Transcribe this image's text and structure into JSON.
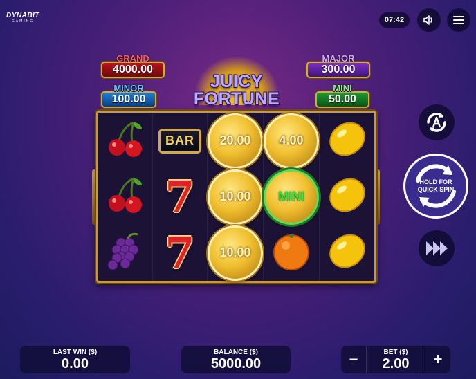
{
  "header": {
    "logo_line1": "DYNABIT",
    "logo_line2": "GAMING",
    "clock": "07:42"
  },
  "jackpots": {
    "grand": {
      "label": "GRAND",
      "value": "4000.00"
    },
    "minor": {
      "label": "MINOR",
      "value": "100.00"
    },
    "major": {
      "label": "MAJOR",
      "value": "300.00"
    },
    "mini": {
      "label": "MINI",
      "value": "50.00"
    }
  },
  "title": {
    "line1": "JUICY",
    "line2": "FORTUNE"
  },
  "reels": {
    "r0": [
      {
        "type": "cherry"
      },
      {
        "type": "bar",
        "text": "BAR"
      },
      {
        "type": "coin",
        "text": "20.00"
      },
      {
        "type": "coin",
        "text": "4.00"
      },
      {
        "type": "lemon"
      }
    ],
    "r1": [
      {
        "type": "cherry"
      },
      {
        "type": "seven",
        "text": "7"
      },
      {
        "type": "coin",
        "text": "10.00"
      },
      {
        "type": "coin_mini",
        "text": "MINI"
      },
      {
        "type": "lemon"
      }
    ],
    "r2": [
      {
        "type": "grapes"
      },
      {
        "type": "seven",
        "text": "7"
      },
      {
        "type": "coin",
        "text": "10.00"
      },
      {
        "type": "orange"
      },
      {
        "type": "lemon"
      }
    ]
  },
  "controls": {
    "spin_label_line1": "HOLD FOR",
    "spin_label_line2": "QUICK SPIN",
    "icons": [
      "autoplay-icon",
      "spin-icon",
      "turbo-icon",
      "sound-icon",
      "menu-icon"
    ]
  },
  "footer": {
    "last_win_label": "LAST WIN ($)",
    "last_win_value": "0.00",
    "balance_label": "BALANCE ($)",
    "balance_value": "5000.00",
    "bet_label": "BET ($)",
    "bet_value": "2.00",
    "minus": "−",
    "plus": "+"
  },
  "colors": {
    "background": "#4b1f78",
    "frame_gold": "#c89a3b",
    "panel": "#120e3a"
  }
}
